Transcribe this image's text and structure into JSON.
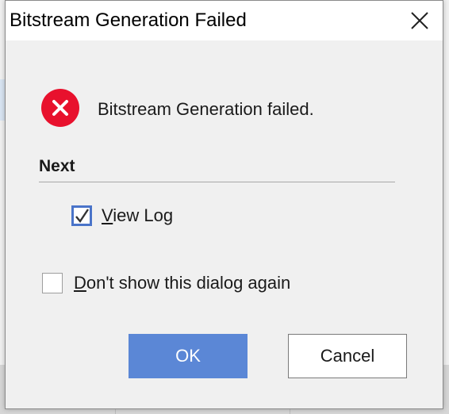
{
  "dialog": {
    "title": "Bitstream Generation Failed",
    "close_icon": "close-icon",
    "message": "Bitstream Generation failed.",
    "status_icon": "error-icon",
    "next_label": "Next",
    "view_log": {
      "mnemonic": "V",
      "rest": "iew Log",
      "checked": true
    },
    "dont_show": {
      "mnemonic": "D",
      "rest": "on't show this dialog again",
      "checked": false
    },
    "ok_label": "OK",
    "cancel_label": "Cancel"
  },
  "colors": {
    "error_red": "#e8112d",
    "ok_button": "#5b87d6",
    "checkbox_accent": "#4a74c9"
  }
}
